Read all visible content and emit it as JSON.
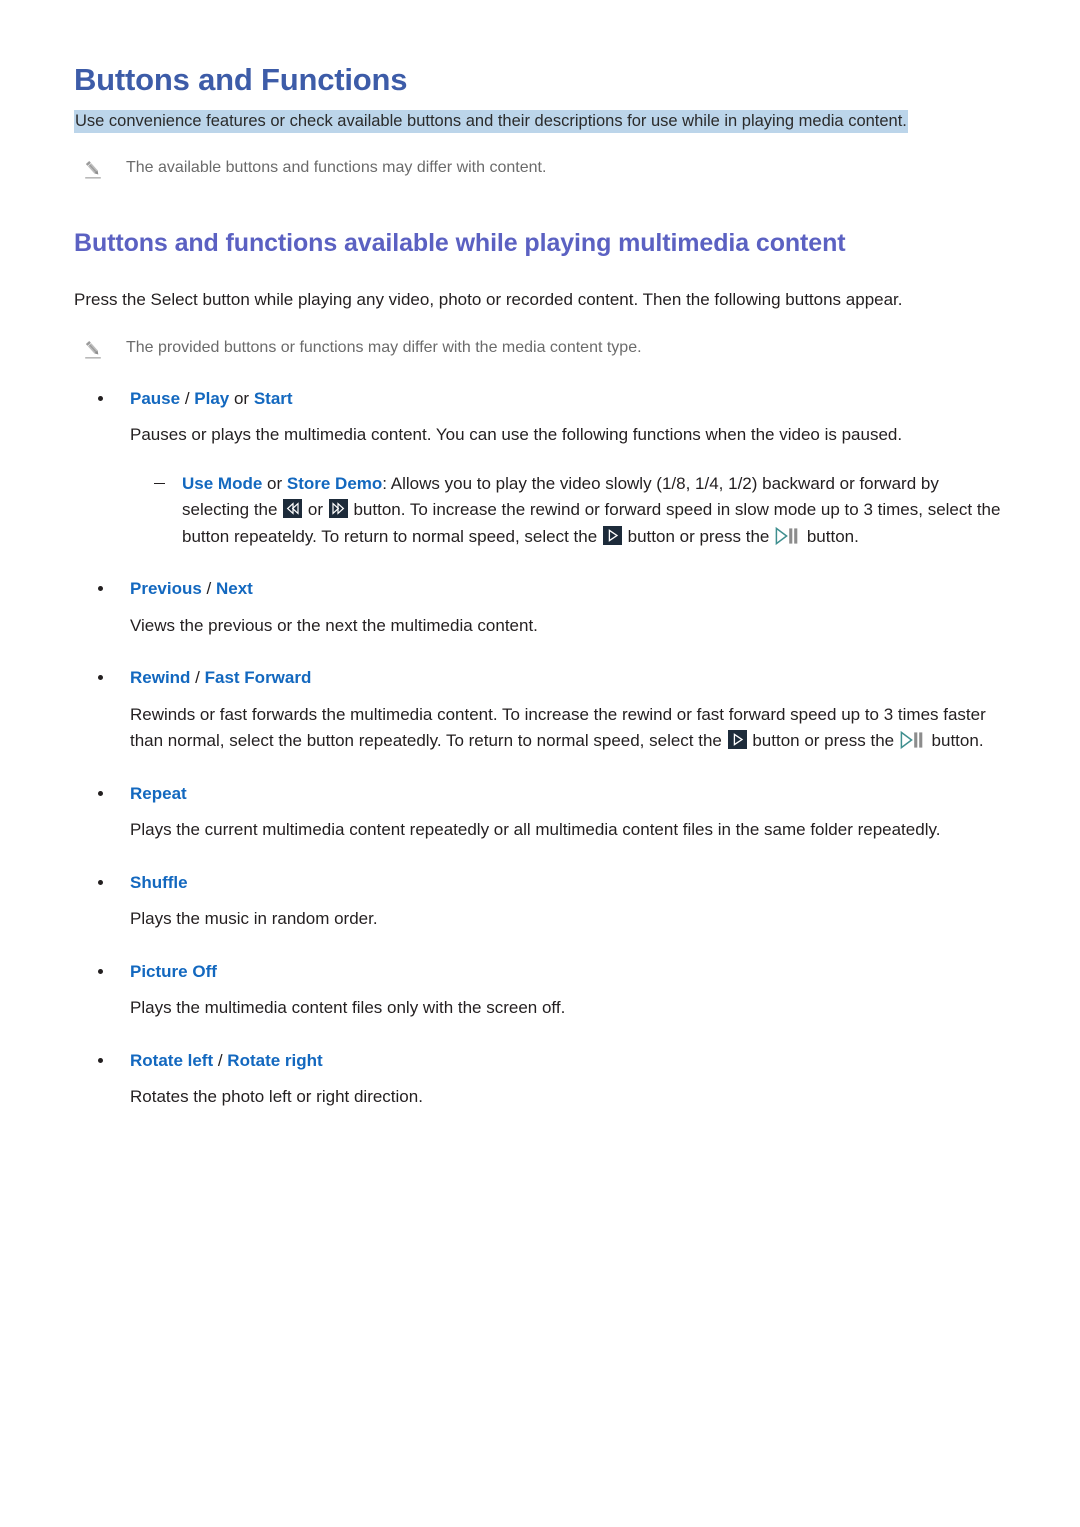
{
  "document": {
    "title": "Buttons and Functions",
    "subtitle": "Use convenience features or check available buttons and their descriptions for use while in playing media content.",
    "top_note": "The available buttons and functions may differ  with content."
  },
  "section": {
    "heading": "Buttons and functions available while playing multimedia content",
    "intro": "Press the Select button while playing any video, photo or recorded content. Then the following buttons appear.",
    "note": "The provided buttons or functions may differ with the media content type."
  },
  "bullets": [
    {
      "terms": [
        "Pause",
        "Play",
        "Start"
      ],
      "sep1": " / ",
      "sep2": " or ",
      "body": "Pauses or plays the multimedia content. You can use the following functions when the video is paused.",
      "sub": {
        "term1": "Use Mode",
        "joiner": " or ",
        "term2": "Store Demo",
        "text_a": ": Allows you to play the video slowly (1/8, 1/4, 1/2) backward or forward by selecting the ",
        "text_b": " or ",
        "text_c": " button. To increase the rewind or forward speed in slow mode up to 3 times, select the button repeateldy. To return to normal speed, select the ",
        "text_d": " button or press the ",
        "text_e": " button."
      }
    },
    {
      "terms": [
        "Previous",
        "Next"
      ],
      "sep1": " / ",
      "body": "Views the previous or the next the multimedia content."
    },
    {
      "terms": [
        "Rewind",
        "Fast Forward"
      ],
      "sep1": " / ",
      "body_a": "Rewinds or fast forwards the multimedia content. To increase the rewind or fast forward speed up to 3 times faster than normal, select the button repeatedly. To return to normal speed, select the ",
      "body_b": " button or press the ",
      "body_c": " button."
    },
    {
      "terms": [
        "Repeat"
      ],
      "body": "Plays the current multimedia content repeatedly or all multimedia content files in the same folder repeatedly."
    },
    {
      "terms": [
        "Shuffle"
      ],
      "body": "Plays the music in random order."
    },
    {
      "terms": [
        "Picture Off"
      ],
      "body": "Plays the multimedia content files only with the screen off."
    },
    {
      "terms": [
        "Rotate left",
        "Rotate right"
      ],
      "sep1": " / ",
      "body": "Rotates the photo left or right direction."
    }
  ],
  "icons": {
    "pencil": "pencil-icon",
    "rewind_key": "rewind-key-icon",
    "forward_key": "fast-forward-key-icon",
    "play_key": "play-key-icon",
    "play_pause_key": "play-pause-key-icon"
  },
  "colors": {
    "title_blue": "#3d5ca8",
    "heading_purple": "#5b61c2",
    "link_blue": "#1368bf",
    "highlight": "#bcd5ea",
    "key_bg": "#1d2b3a",
    "teal": "#3f8f8f",
    "body_text": "#231f20",
    "note_text": "#6b6b6b"
  }
}
